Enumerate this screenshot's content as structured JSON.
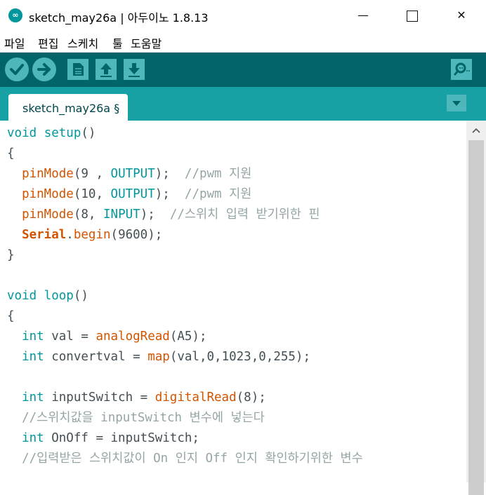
{
  "window": {
    "title": "sketch_may26a | 아두이노 1.8.13",
    "app_icon_glyph": "∞",
    "minimize_glyph": "—",
    "close_glyph": "✕"
  },
  "menu": {
    "items": [
      {
        "label": "파일"
      },
      {
        "label": "편집"
      },
      {
        "label": "스케치"
      },
      {
        "label": "툴"
      },
      {
        "label": "도움말"
      }
    ]
  },
  "toolbar": {
    "icons": [
      "verify-icon",
      "upload-icon",
      "new-icon",
      "open-icon",
      "save-icon",
      "serial-monitor-icon"
    ]
  },
  "tabs": {
    "active_label": "sketch_may26a §"
  },
  "colors": {
    "toolbar_bg": "#006468",
    "tabbar_bg": "#17a1a5",
    "button_bg": "#4db7bb",
    "keyword": "#00979c",
    "function": "#d35400",
    "comment": "#95a5a6",
    "text": "#434f54"
  },
  "editor": {
    "lines": [
      [
        {
          "t": "void",
          "c": "kw"
        },
        {
          "t": " "
        },
        {
          "t": "setup",
          "c": "kw"
        },
        {
          "t": "()"
        }
      ],
      [
        {
          "t": "{"
        }
      ],
      [
        {
          "t": "  "
        },
        {
          "t": "pinMode",
          "c": "fn"
        },
        {
          "t": "(9 , "
        },
        {
          "t": "OUTPUT",
          "c": "kw"
        },
        {
          "t": ");  "
        },
        {
          "t": "//pwm 지원",
          "c": "cm"
        }
      ],
      [
        {
          "t": "  "
        },
        {
          "t": "pinMode",
          "c": "fn"
        },
        {
          "t": "(10, "
        },
        {
          "t": "OUTPUT",
          "c": "kw"
        },
        {
          "t": ");  "
        },
        {
          "t": "//pwm 지원",
          "c": "cm"
        }
      ],
      [
        {
          "t": "  "
        },
        {
          "t": "pinMode",
          "c": "fn"
        },
        {
          "t": "(8, "
        },
        {
          "t": "INPUT",
          "c": "kw"
        },
        {
          "t": ");  "
        },
        {
          "t": "//스위치 입력 받기위한 핀",
          "c": "cm"
        }
      ],
      [
        {
          "t": "  "
        },
        {
          "t": "Serial",
          "c": "cls"
        },
        {
          "t": "."
        },
        {
          "t": "begin",
          "c": "fn"
        },
        {
          "t": "(9600);"
        }
      ],
      [
        {
          "t": "}"
        }
      ],
      [],
      [
        {
          "t": "void",
          "c": "kw"
        },
        {
          "t": " "
        },
        {
          "t": "loop",
          "c": "kw"
        },
        {
          "t": "()"
        }
      ],
      [
        {
          "t": "{"
        }
      ],
      [
        {
          "t": "  "
        },
        {
          "t": "int",
          "c": "kw"
        },
        {
          "t": " val = "
        },
        {
          "t": "analogRead",
          "c": "fn"
        },
        {
          "t": "(A5);"
        }
      ],
      [
        {
          "t": "  "
        },
        {
          "t": "int",
          "c": "kw"
        },
        {
          "t": " convertval = "
        },
        {
          "t": "map",
          "c": "fn"
        },
        {
          "t": "(val,0,1023,0,255);"
        }
      ],
      [],
      [
        {
          "t": "  "
        },
        {
          "t": "int",
          "c": "kw"
        },
        {
          "t": " inputSwitch = "
        },
        {
          "t": "digitalRead",
          "c": "fn"
        },
        {
          "t": "(8);"
        }
      ],
      [
        {
          "t": "  "
        },
        {
          "t": "//스위치값을 inputSwitch 변수에 넣는다",
          "c": "cm"
        }
      ],
      [
        {
          "t": "  "
        },
        {
          "t": "int",
          "c": "kw"
        },
        {
          "t": " OnOff = inputSwitch;"
        }
      ],
      [
        {
          "t": "  "
        },
        {
          "t": "//입력받은 스위치값이 On 인지 Off 인지 확인하기위한 변수",
          "c": "cm"
        }
      ]
    ]
  }
}
